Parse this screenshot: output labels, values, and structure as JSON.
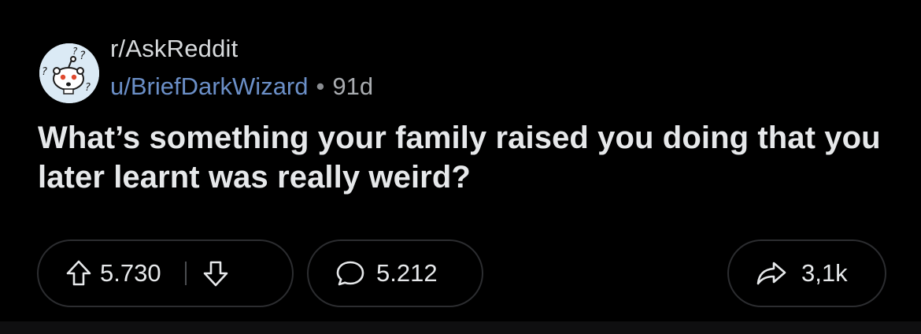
{
  "post": {
    "subreddit": "r/AskReddit",
    "author": "u/BriefDarkWizard",
    "separator": "•",
    "age": "91d",
    "title": "What’s something your family raised you doing that you later learnt was really weird?"
  },
  "actions": {
    "upvote_icon": "arrow-up-icon",
    "vote_count": "5.730",
    "downvote_icon": "arrow-down-icon",
    "comment_icon": "speech-bubble-icon",
    "comment_count": "5.212",
    "share_icon": "share-arrow-icon",
    "share_count": "3,1k"
  },
  "colors": {
    "background": "#000000",
    "text": "#e6e8ea",
    "username": "#6b8fc7",
    "muted": "#a9acb0",
    "pill_border": "#2c2d30",
    "avatar_bg": "#dbeaf5"
  }
}
